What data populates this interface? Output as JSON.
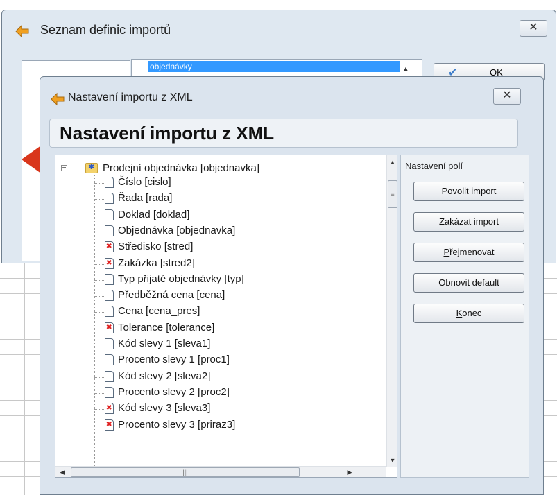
{
  "outer_window": {
    "title": "Seznam definic importů",
    "close_label": "✕",
    "list_selected_item": "objednávky",
    "ok_label": "OK"
  },
  "inner_window": {
    "title": "Nastavení importu z XML",
    "close_label": "✕",
    "header": "Nastavení importu z XML",
    "tree": {
      "root_label": "Prodejní objednávka [objednavka]",
      "items": [
        {
          "label": "Číslo [cislo]",
          "enabled": true
        },
        {
          "label": "Řada [rada]",
          "enabled": true
        },
        {
          "label": "Doklad [doklad]",
          "enabled": true
        },
        {
          "label": "Objednávka [objednavka]",
          "enabled": true
        },
        {
          "label": "Středisko [stred]",
          "enabled": false
        },
        {
          "label": "Zakázka [stred2]",
          "enabled": false
        },
        {
          "label": "Typ přijaté objednávky [typ]",
          "enabled": true
        },
        {
          "label": "Předběžná cena [cena]",
          "enabled": true
        },
        {
          "label": "Cena [cena_pres]",
          "enabled": true
        },
        {
          "label": "Tolerance [tolerance]",
          "enabled": false
        },
        {
          "label": "Kód slevy 1 [sleva1]",
          "enabled": true
        },
        {
          "label": "Procento slevy 1 [proc1]",
          "enabled": true
        },
        {
          "label": "Kód slevy 2 [sleva2]",
          "enabled": true
        },
        {
          "label": "Procento slevy 2 [proc2]",
          "enabled": true
        },
        {
          "label": "Kód slevy 3 [sleva3]",
          "enabled": false
        },
        {
          "label": "Procento slevy 3 [priraz3]",
          "enabled": false
        }
      ]
    },
    "right_panel": {
      "title": "Nastavení polí",
      "buttons": {
        "enable_import": "Povolit import",
        "disable_import": "Zakázat import",
        "rename_first": "P",
        "rename_rest": "řejmenovat",
        "restore_default": "Obnovit default",
        "close_first": "K",
        "close_rest": "onec"
      }
    }
  },
  "colors": {
    "selection": "#3399ff",
    "disabled_mark": "#e02020",
    "window_bg": "#dbe4ee"
  }
}
